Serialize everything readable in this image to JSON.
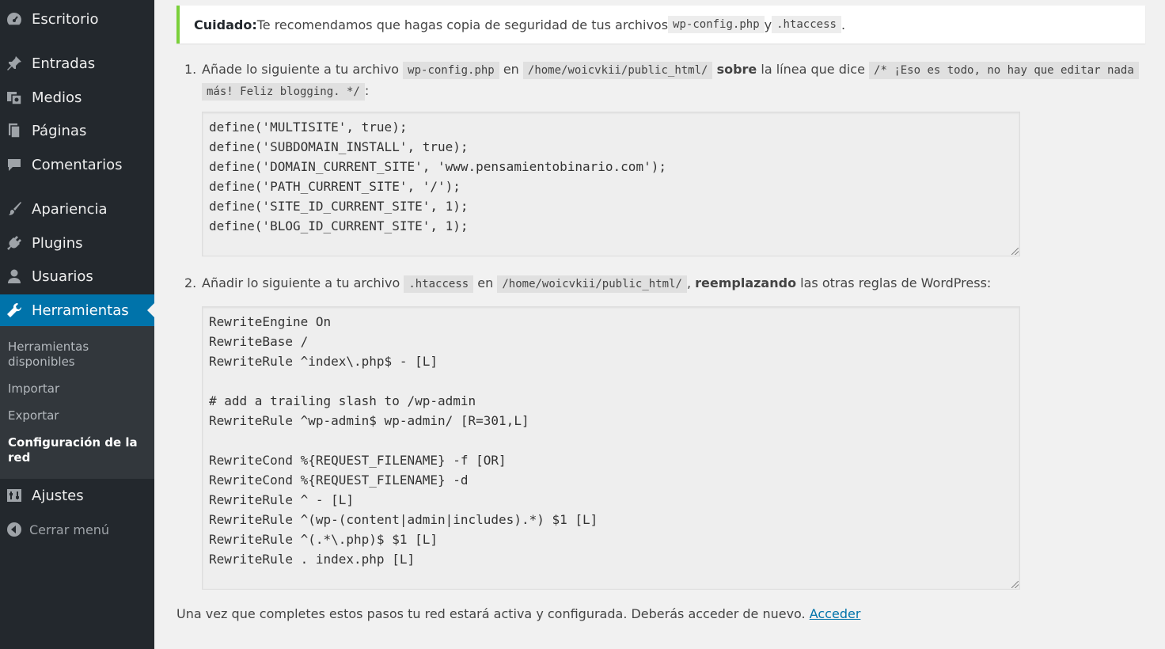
{
  "sidebar": {
    "menu": [
      {
        "label": "Escritorio",
        "icon": "dashboard-icon"
      },
      {
        "label": "Entradas",
        "icon": "pushpin-icon"
      },
      {
        "label": "Medios",
        "icon": "media-icon"
      },
      {
        "label": "Páginas",
        "icon": "pages-icon"
      },
      {
        "label": "Comentarios",
        "icon": "comment-icon"
      },
      {
        "label": "Apariencia",
        "icon": "brush-icon"
      },
      {
        "label": "Plugins",
        "icon": "plug-icon"
      },
      {
        "label": "Usuarios",
        "icon": "user-icon"
      },
      {
        "label": "Herramientas",
        "icon": "wrench-icon"
      }
    ],
    "submenu": [
      {
        "label": "Herramientas disponibles"
      },
      {
        "label": "Importar"
      },
      {
        "label": "Exportar"
      },
      {
        "label": "Configuración de la red"
      }
    ],
    "settings": {
      "label": "Ajustes",
      "icon": "settings-icon"
    },
    "collapse": {
      "label": "Cerrar menú",
      "icon": "collapse-arrow-icon"
    },
    "colors": {
      "bg": "#23282d",
      "submenu_bg": "#32373c",
      "active": "#0073aa"
    }
  },
  "notice": {
    "strong": "Cuidado:",
    "text": " Te recomendamos que hagas copia de seguridad de tus archivos ",
    "file1": "wp-config.php",
    "and": " y ",
    "file2": ".htaccess",
    "end": ".",
    "border_color": "#7ad03a"
  },
  "step1": {
    "num": "1.",
    "t1": "Añade lo siguiente a tu archivo ",
    "code1": "wp-config.php",
    "t2": " en ",
    "code2": "/home/woicvkii/public_html/",
    "strong": "sobre",
    "t3": " la línea que dice ",
    "code3a": "/* ¡Eso es todo, no hay que editar nada",
    "code3b": "más! Feliz blogging. */",
    "t4": ":",
    "code_lines": [
      "define('MULTISITE', true);",
      "define('SUBDOMAIN_INSTALL', true);",
      "define('DOMAIN_CURRENT_SITE', 'www.pensamientobinario.com');",
      "define('PATH_CURRENT_SITE', '/');",
      "define('SITE_ID_CURRENT_SITE', 1);",
      "define('BLOG_ID_CURRENT_SITE', 1);"
    ]
  },
  "step2": {
    "num": "2.",
    "t1": "Añadir lo siguiente a tu archivo ",
    "code1": ".htaccess",
    "t2": " en ",
    "code2": "/home/woicvkii/public_html/",
    "t3": ", ",
    "strong": "reemplazando",
    "t4": " las otras reglas de WordPress:",
    "code_lines": [
      "RewriteEngine On",
      "RewriteBase /",
      "RewriteRule ^index\\.php$ - [L]",
      "",
      "# add a trailing slash to /wp-admin",
      "RewriteRule ^wp-admin$ wp-admin/ [R=301,L]",
      "",
      "RewriteCond %{REQUEST_FILENAME} -f [OR]",
      "RewriteCond %{REQUEST_FILENAME} -d",
      "RewriteRule ^ - [L]",
      "RewriteRule ^(wp-(content|admin|includes).*) $1 [L]",
      "RewriteRule ^(.*\\.php)$ $1 [L]",
      "RewriteRule . index.php [L]"
    ]
  },
  "final": {
    "text": "Una vez que completes estos pasos tu red estará activa y configurada. Deberás acceder de nuevo. ",
    "link": "Acceder",
    "link_color": "#0073aa"
  }
}
